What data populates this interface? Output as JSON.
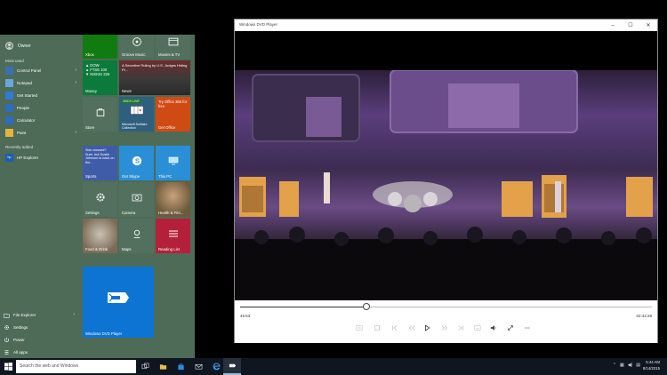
{
  "start_menu": {
    "user": {
      "name": "Owner"
    },
    "most_used_label": "Most used",
    "most_used": [
      {
        "label": "Control Panel",
        "icon": "control-panel-icon",
        "color": "#3c6fb4",
        "has_submenu": true
      },
      {
        "label": "Notepad",
        "icon": "notepad-icon",
        "color": "#6aa7d8",
        "has_submenu": true
      },
      {
        "label": "Get Started",
        "icon": "lightbulb-icon",
        "color": "#2f7bd6",
        "has_submenu": false
      },
      {
        "label": "People",
        "icon": "people-icon",
        "color": "#2d6cc0",
        "has_submenu": false
      },
      {
        "label": "Calculator",
        "icon": "calculator-icon",
        "color": "#2d6cc0",
        "has_submenu": false
      },
      {
        "label": "Paint",
        "icon": "paint-icon",
        "color": "#e8b33a",
        "has_submenu": true
      }
    ],
    "recently_added_label": "Recently added",
    "recently_added": [
      {
        "label": "HP Explorer",
        "icon": "hp-icon",
        "color": "#1a5fb4",
        "has_submenu": false
      }
    ],
    "bottom": [
      {
        "label": "File Explorer",
        "icon": "folder-icon",
        "has_submenu": true
      },
      {
        "label": "Settings",
        "icon": "gear-icon",
        "has_submenu": false
      },
      {
        "label": "Power",
        "icon": "power-icon",
        "has_submenu": false
      },
      {
        "label": "All apps",
        "icon": "list-icon",
        "has_submenu": false
      }
    ]
  },
  "tiles": {
    "xbox": {
      "label": "Xbox",
      "color": "#107c10"
    },
    "groove": {
      "label": "Groove Music",
      "color": "#52705d"
    },
    "movies": {
      "label": "Movies & TV",
      "color": "#52705d"
    },
    "money": {
      "label": "Money",
      "color": "#0c7a3a",
      "lines": [
        "▲ DOW",
        "▲ FTSE 100",
        "▼ NIKKEI 225"
      ]
    },
    "news": {
      "label": "News",
      "color": "#b3262b",
      "headline": "A Secretive Ruling by U.S. Judges Hiding Pr..."
    },
    "store": {
      "label": "Store",
      "color": "#52705d"
    },
    "solitaire": {
      "label": "Microsoft Solitaire Collection",
      "color": "#2f5f7f",
      "badge": "XBOX LIVE"
    },
    "office": {
      "label": "Get Office",
      "color": "#d04a14",
      "text": "Try Office 365 for free"
    },
    "sports": {
      "label": "Sports",
      "color": "#3f5ca8",
      "text": "Star crossed? Sure, but Dustin Johnson is back on the..."
    },
    "skype": {
      "label": "Get Skype",
      "color": "#2a8fd6"
    },
    "thispc": {
      "label": "This PC",
      "color": "#2a8fd6"
    },
    "settings": {
      "label": "Settings",
      "color": "#52705d"
    },
    "camera": {
      "label": "Camera",
      "color": "#52705d"
    },
    "health": {
      "label": "Health & Fitn...",
      "color": "#6d5a3b"
    },
    "food": {
      "label": "Food & Drink",
      "color": "#7a6a55"
    },
    "maps": {
      "label": "Maps",
      "color": "#52705d"
    },
    "reading": {
      "label": "Reading List",
      "color": "#b4203a"
    },
    "dvd": {
      "label": "Windows DVD Player",
      "color": "#0d74d4"
    }
  },
  "dvd_window": {
    "title": "Windows DVD Player",
    "time_elapsed": "45:53",
    "time_total": "02:42:28",
    "progress": 0.306,
    "controls": [
      "menu-icon",
      "stop-icon",
      "skip-back-icon",
      "rewind-icon",
      "play-icon",
      "fast-forward-icon",
      "skip-forward-icon",
      "subtitles-icon",
      "volume-icon",
      "fullscreen-icon",
      "more-icon"
    ]
  },
  "taskbar": {
    "search_placeholder": "Search the web and Windows",
    "time": "5:44 AM",
    "date": "8/14/2015"
  }
}
